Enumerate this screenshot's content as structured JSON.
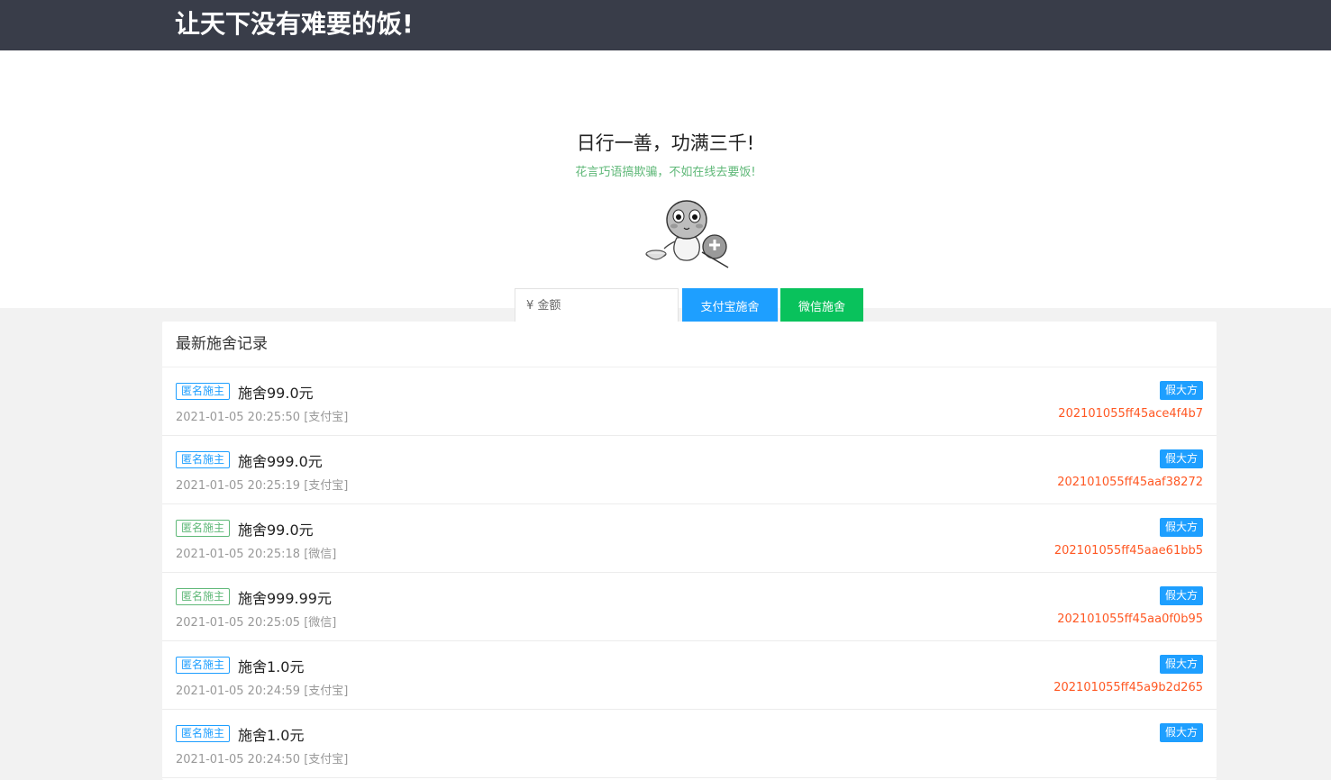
{
  "header": {
    "title": "让天下没有难要的饭!"
  },
  "hero": {
    "headline": "日行一善，功满三千!",
    "subline": "花言巧语搞欺骗，不如在线去要饭!",
    "amount_placeholder": "¥ 金额",
    "alipay_label": "支付宝施舍",
    "wechat_label": "微信施舍"
  },
  "records": {
    "title": "最新施舍记录",
    "items": [
      {
        "donor": "匿名施主",
        "amount": "施舍99.0元",
        "time": "2021-01-05 20:25:50",
        "method": "[支付宝]",
        "badge": "假大方",
        "order": "202101055ff45ace4f4b7"
      },
      {
        "donor": "匿名施主",
        "amount": "施舍999.0元",
        "time": "2021-01-05 20:25:19",
        "method": "[支付宝]",
        "badge": "假大方",
        "order": "202101055ff45aaf38272"
      },
      {
        "donor": "匿名施主",
        "amount": "施舍99.0元",
        "time": "2021-01-05 20:25:18",
        "method": "[微信]",
        "badge": "假大方",
        "order": "202101055ff45aae61bb5"
      },
      {
        "donor": "匿名施主",
        "amount": "施舍999.99元",
        "time": "2021-01-05 20:25:05",
        "method": "[微信]",
        "badge": "假大方",
        "order": "202101055ff45aa0f0b95"
      },
      {
        "donor": "匿名施主",
        "amount": "施舍1.0元",
        "time": "2021-01-05 20:24:59",
        "method": "[支付宝]",
        "badge": "假大方",
        "order": "202101055ff45a9b2d265"
      },
      {
        "donor": "匿名施主",
        "amount": "施舍1.0元",
        "time": "2021-01-05 20:24:50",
        "method": "[支付宝]",
        "badge": "假大方",
        "order": ""
      }
    ]
  },
  "colors": {
    "topbar": "#393d49",
    "alipay": "#1e9fff",
    "wechat": "#09c25c",
    "order": "#ff5722",
    "donor_alipay": "#1e9fff",
    "donor_wechat": "#5fb878"
  }
}
